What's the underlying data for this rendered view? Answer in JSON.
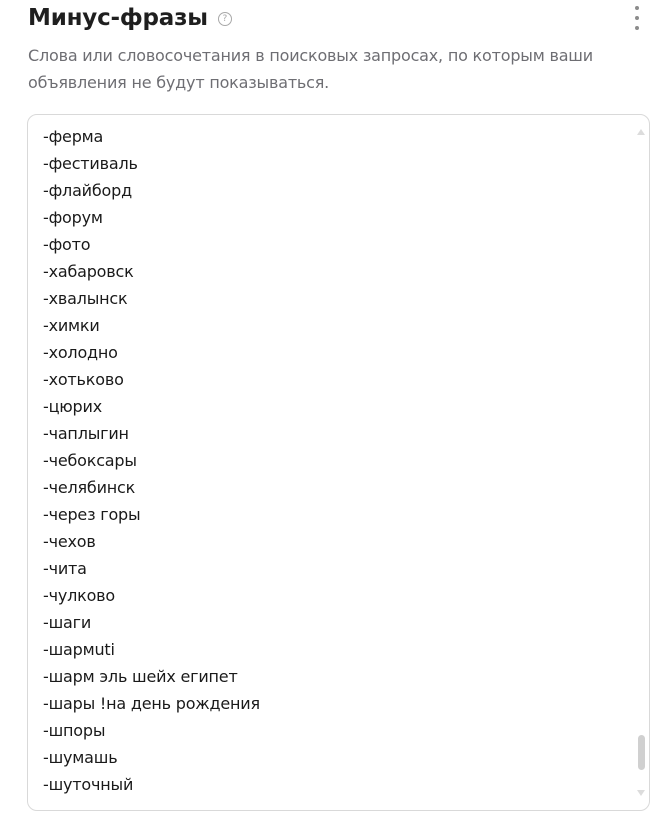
{
  "header": {
    "title": "Минус-фразы",
    "help_glyph": "?",
    "help_icon": "question-circle-icon",
    "menu_icon": "kebab-menu-icon"
  },
  "description": "Слова или словосочетания в поисковых запросах, по которым ваши объявления не будут показываться.",
  "phrases": [
    "-ферма",
    "-фестиваль",
    "-флайборд",
    "-форум",
    "-фото",
    "-хабаровск",
    "-хвалынск",
    "-химки",
    "-холодно",
    "-хотьково",
    "-цюрих",
    "-чаплыгин",
    "-чебоксары",
    "-челябинск",
    "-через горы",
    "-чехов",
    "-чита",
    "-чулково",
    "-шаги",
    "-шармuti",
    "-шарм эль шейх египет",
    "-шары !на день рождения",
    "-шпоры",
    "-шумашь",
    "-шуточный"
  ],
  "colors": {
    "title": "#1f1f1f",
    "description": "#6e6e73",
    "border": "#d9d9d9",
    "scroll_thumb": "#d0d0d0"
  }
}
